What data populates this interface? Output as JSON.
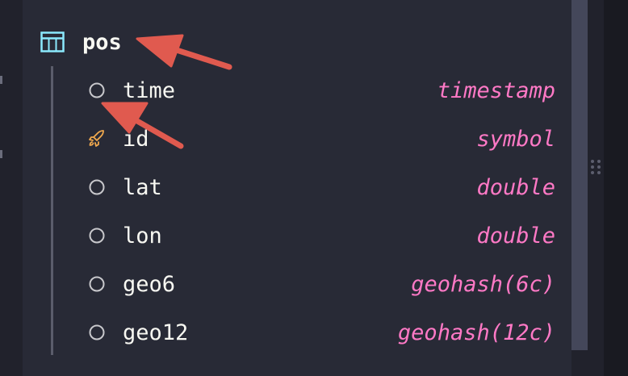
{
  "table": {
    "name": "pos",
    "icon": "table-icon"
  },
  "columns": [
    {
      "name": "time",
      "type": "timestamp",
      "icon": "circle-icon"
    },
    {
      "name": "id",
      "type": "symbol",
      "icon": "rocket-icon"
    },
    {
      "name": "lat",
      "type": "double",
      "icon": "circle-icon"
    },
    {
      "name": "lon",
      "type": "double",
      "icon": "circle-icon"
    },
    {
      "name": "geo6",
      "type": "geohash(6c)",
      "icon": "circle-icon"
    },
    {
      "name": "geo12",
      "type": "geohash(12c)",
      "icon": "circle-icon"
    }
  ],
  "colors": {
    "panel_bg": "#282a36",
    "type_text": "#ff79c6",
    "table_icon": "#8be9fd",
    "designated_icon": "#f1a94e",
    "annotation_arrow": "#e05a4f"
  }
}
